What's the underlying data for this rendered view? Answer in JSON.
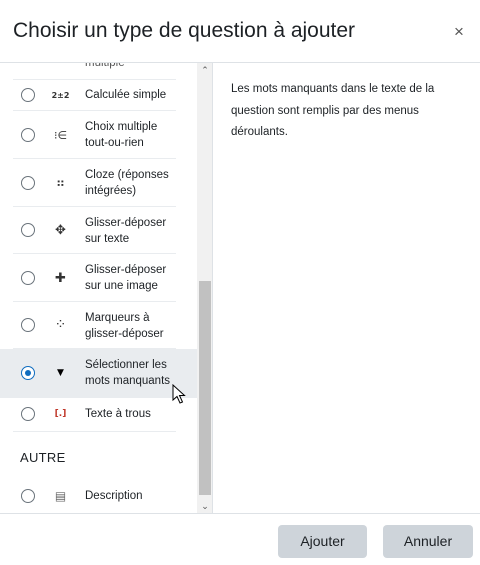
{
  "modal": {
    "title": "Choisir un type de question à ajouter",
    "close_icon": "×"
  },
  "list": {
    "partial_item_label": "multiple",
    "items": [
      {
        "label": "Calculée simple",
        "icon": "calculated-simple-icon",
        "icon_glyph": "2±2",
        "checked": false
      },
      {
        "label": "Choix multiple\ntout-ou-rien",
        "icon": "multichoice-allornothing-icon",
        "icon_glyph": "⁝∈",
        "checked": false
      },
      {
        "label": "Cloze (réponses\nintégrées)",
        "icon": "cloze-icon",
        "icon_glyph": "⠶",
        "checked": false
      },
      {
        "label": "Glisser-déposer\nsur texte",
        "icon": "drag-drop-text-icon",
        "icon_glyph": "✥",
        "checked": false
      },
      {
        "label": "Glisser-déposer\nsur une image",
        "icon": "drag-drop-image-icon",
        "icon_glyph": "✚",
        "checked": false
      },
      {
        "label": "Marqueurs à\nglisser-déposer",
        "icon": "drag-drop-markers-icon",
        "icon_glyph": "⁘",
        "checked": false
      },
      {
        "label": "Sélectionner les\nmots manquants",
        "icon": "select-missing-words-icon",
        "icon_glyph": "▼",
        "checked": true
      },
      {
        "label": "Texte à trous",
        "icon": "gapfill-icon",
        "icon_glyph": "[.]",
        "checked": false
      }
    ],
    "section_other": "AUTRE",
    "other_items": [
      {
        "label": "Description",
        "icon": "description-icon",
        "icon_glyph": "▤",
        "checked": false
      }
    ]
  },
  "description": {
    "text": "Les mots manquants dans le texte de la question sont remplis par des menus déroulants."
  },
  "footer": {
    "add_label": "Ajouter",
    "cancel_label": "Annuler"
  },
  "colors": {
    "accent": "#0f6cbf",
    "selected_row": "#e9ecef",
    "button_bg": "#ced4da"
  }
}
